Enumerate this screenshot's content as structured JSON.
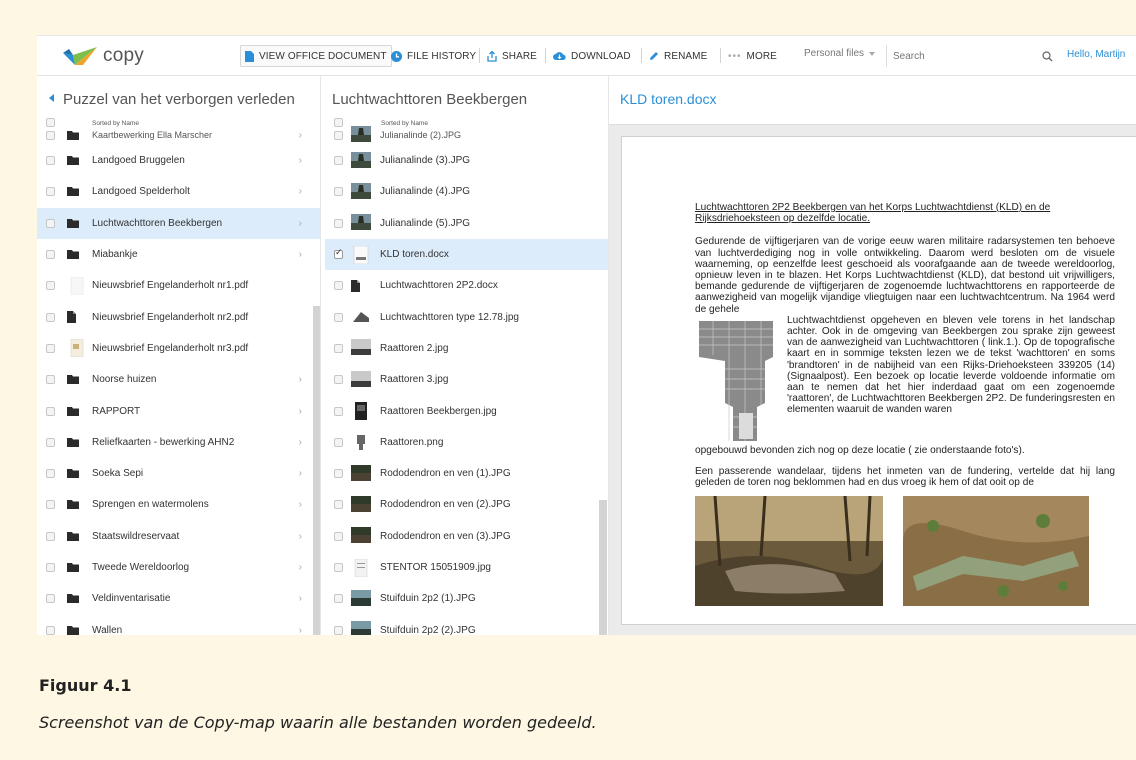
{
  "toolbar": {
    "logo": "copy",
    "view_office": "VIEW OFFICE DOCUMENT",
    "file_history": "FILE HISTORY",
    "share": "SHARE",
    "download": "DOWNLOAD",
    "rename": "RENAME",
    "more": "MORE",
    "personal_files": "Personal files",
    "search_placeholder": "Search",
    "greeting": "Hello, Martijn"
  },
  "col1": {
    "title": "Puzzel van het verborgen verleden",
    "sorted": "Sorted by Name",
    "items": [
      {
        "label": "Kaartbewerking Ella Marscher",
        "type": "folder"
      },
      {
        "label": "Landgoed Bruggelen",
        "type": "folder"
      },
      {
        "label": "Landgoed Spelderholt",
        "type": "folder"
      },
      {
        "label": "Luchtwachttoren Beekbergen",
        "type": "folder"
      },
      {
        "label": "Miabankje",
        "type": "folder"
      },
      {
        "label": "Nieuwsbrief Engelanderholt nr1.pdf",
        "type": "pdf-blank"
      },
      {
        "label": "Nieuwsbrief Engelanderholt nr2.pdf",
        "type": "file"
      },
      {
        "label": "Nieuwsbrief Engelanderholt nr3.pdf",
        "type": "pdf-thumb"
      },
      {
        "label": "Noorse huizen",
        "type": "folder"
      },
      {
        "label": "RAPPORT",
        "type": "folder"
      },
      {
        "label": "Reliefkaarten - bewerking AHN2",
        "type": "folder"
      },
      {
        "label": "Soeka Sepi",
        "type": "folder"
      },
      {
        "label": "Sprengen en watermolens",
        "type": "folder"
      },
      {
        "label": "Staatswildreservaat",
        "type": "folder"
      },
      {
        "label": "Tweede Wereldoorlog",
        "type": "folder"
      },
      {
        "label": "Veldinventarisatie",
        "type": "folder"
      },
      {
        "label": "Wallen",
        "type": "folder"
      }
    ]
  },
  "col2": {
    "title": "Luchtwachttoren Beekbergen",
    "sorted": "Sorted by Name",
    "items": [
      {
        "label": "Julianalinde (2).JPG",
        "thumb": "tree"
      },
      {
        "label": "Julianalinde (3).JPG",
        "thumb": "tree"
      },
      {
        "label": "Julianalinde (4).JPG",
        "thumb": "tree"
      },
      {
        "label": "Julianalinde (5).JPG",
        "thumb": "tree"
      },
      {
        "label": "KLD toren.docx",
        "thumb": "doc"
      },
      {
        "label": "Luchtwachttoren 2P2.docx",
        "thumb": "file"
      },
      {
        "label": "Luchtwachttoren type 12.78.jpg",
        "thumb": "tower"
      },
      {
        "label": "Raattoren 2.jpg",
        "thumb": "ground"
      },
      {
        "label": "Raattoren 3.jpg",
        "thumb": "ground"
      },
      {
        "label": "Raattoren Beekbergen.jpg",
        "thumb": "tall"
      },
      {
        "label": "Raattoren.png",
        "thumb": "png"
      },
      {
        "label": "Rododendron en ven (1).JPG",
        "thumb": "forest"
      },
      {
        "label": "Rododendron en ven (2).JPG",
        "thumb": "forest"
      },
      {
        "label": "Rododendron en ven (3).JPG",
        "thumb": "forest"
      },
      {
        "label": "STENTOR 15051909.jpg",
        "thumb": "paper"
      },
      {
        "label": "Stuifduin 2p2 (1).JPG",
        "thumb": "dune"
      },
      {
        "label": "Stuifduin 2p2 (2).JPG",
        "thumb": "dune"
      }
    ]
  },
  "doc": {
    "title": "KLD toren.docx",
    "heading": "Luchtwachttoren  2P2 Beekbergen van het Korps Luchtwachtdienst  (KLD) en de Rijksdriehoeksteen  op dezelfde locatie.",
    "para1": "Gedurende de vijftigerjaren van de vorige eeuw waren militaire radarsystemen ten behoeve van luchtverdediging nog in volle ontwikkeling. Daarom werd besloten om de visuele waarneming, op eenzelfde leest geschoeid als voorafgaande aan de tweede wereldoorlog, opnieuw leven in te blazen. Het Korps Luchtwachtdienst (KLD), dat bestond uit vrijwilligers, bemande gedurende de vijftigerjaren de zogenoemde luchtwachttorens  en rapporteerde de aanwezigheid van mogelijk vijandige vliegtuigen naar een luchtwachtcentrum.  Na 1964 werd de gehele",
    "para1_wrap": "Luchtwachtdienst  opgeheven en bleven vele torens in het landschap achter.  Ook in de omgeving van Beekbergen zou sprake zijn geweest van de aanwezigheid van Luchtwachttoren ( link.1.).  Op de topografische kaart en in sommige teksten lezen we de tekst 'wachttoren' en soms 'brandtoren' in de nabijheid van een Rijks-Driehoeksteen 339205 (14) (Signaalpost). Een bezoek op locatie leverde voldoende informatie om aan te nemen dat het hier inderdaad gaat om een zogenoemde 'raattoren', de Luchtwachttoren  Beekbergen 2P2. De funderingsresten  en elementen  waaruit de wanden waren",
    "para1_end": "opgebouwd bevonden zich nog op deze locatie ( zie onderstaande foto's).",
    "para2": "Een passerende wandelaar, tijdens het inmeten van de fundering, vertelde dat hij lang geleden de toren nog beklommen had en dus vroeg ik hem of dat ooit op de"
  },
  "figure": {
    "label": "Figuur 4.1",
    "caption": "Screenshot van de Copy-map waarin alle bestanden worden gedeeld."
  },
  "colors": {
    "accent": "#2a8fd6",
    "selected_row": "#dcecfb",
    "page_bg": "#fdf7e4"
  }
}
